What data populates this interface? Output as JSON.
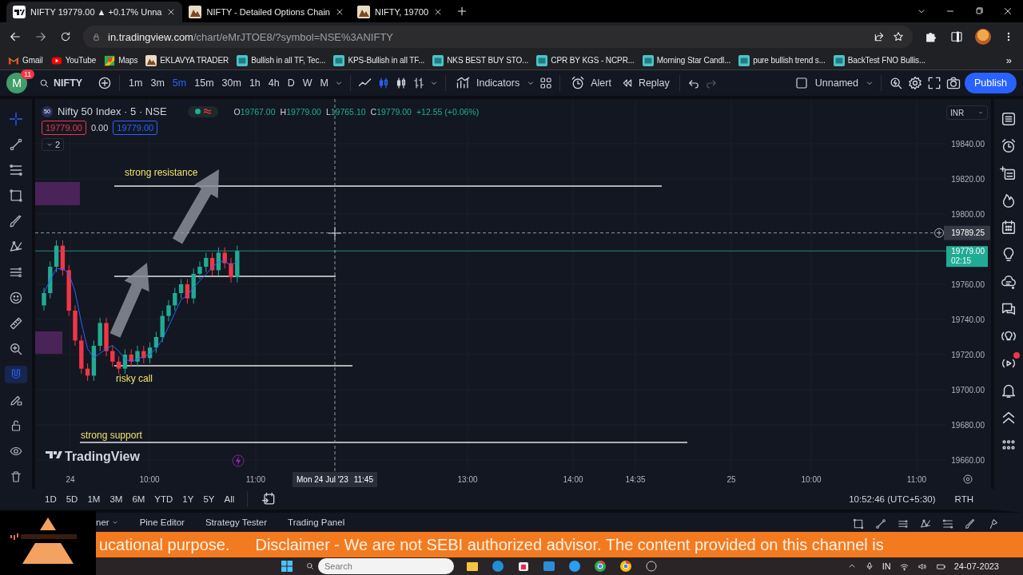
{
  "browser": {
    "tabs": [
      {
        "title": "NIFTY 19779.00 ▲ +0.17% Unna",
        "kind": "chart",
        "selected": true
      },
      {
        "title": "NIFTY - Detailed Options Chain",
        "kind": "site",
        "selected": false
      },
      {
        "title": "NIFTY, 19700",
        "kind": "site",
        "selected": false
      }
    ],
    "address": {
      "domain": "in.tradingview.com",
      "path": "/chart/eMrJTOE8/?symbol=NSE%3ANIFTY"
    },
    "bookmarks": [
      {
        "label": "Gmail",
        "kind": "gmail"
      },
      {
        "label": "YouTube",
        "kind": "youtube"
      },
      {
        "label": "Maps",
        "kind": "maps"
      },
      {
        "label": "EKLAVYA TRADER",
        "kind": "site"
      },
      {
        "label": "Bullish in all TF, Tec...",
        "kind": "screener"
      },
      {
        "label": "KPS-Bullish in all TF...",
        "kind": "screener"
      },
      {
        "label": "NKS BEST BUY STO...",
        "kind": "screener"
      },
      {
        "label": "CPR BY KGS - NCPR...",
        "kind": "screener"
      },
      {
        "label": "Morning Star Candl...",
        "kind": "screener"
      },
      {
        "label": "pure bullish trend s...",
        "kind": "screener"
      },
      {
        "label": "BackTest FNO Bullis...",
        "kind": "screener"
      }
    ],
    "more": "»"
  },
  "toolbar": {
    "avatar": "M",
    "notifications": "11",
    "symbol": "NIFTY",
    "intervals": [
      {
        "label": "1m",
        "selected": false
      },
      {
        "label": "3m",
        "selected": false
      },
      {
        "label": "5m",
        "selected": true
      },
      {
        "label": "15m",
        "selected": false
      },
      {
        "label": "30m",
        "selected": false
      },
      {
        "label": "1h",
        "selected": false
      },
      {
        "label": "4h",
        "selected": false
      },
      {
        "label": "D",
        "selected": false
      },
      {
        "label": "W",
        "selected": false
      },
      {
        "label": "M",
        "selected": false
      }
    ],
    "indicators": "Indicators",
    "alert": "Alert",
    "replay": "Replay",
    "layout": "Unnamed",
    "publish": "Publish"
  },
  "drawing_tools": {
    "magnet_on": true
  },
  "chart": {
    "symbol_badge": "50",
    "title": "Nifty 50 Index · 5 · NSE",
    "ohlc": [
      {
        "label": "O",
        "value": "19767.00"
      },
      {
        "label": "H",
        "value": "19779.00"
      },
      {
        "label": "L",
        "value": "19765.10"
      },
      {
        "label": "C",
        "value": "19779.00"
      }
    ],
    "change": "+12.55 (+0.06%)",
    "sell_price": "19779.00",
    "spread": "0.00",
    "buy_price": "19779.00",
    "indicator_count": "2",
    "currency": "INR",
    "price_ticks": [
      "19840.00",
      "19820.00",
      "19800.00",
      "19760.00",
      "19740.00",
      "19720.00",
      "19700.00",
      "19680.00",
      "19660.00"
    ],
    "crosshair_price": "19789.25",
    "last_price": "19779.00",
    "countdown": "02:15",
    "time_ticks": [
      "24",
      "10:00",
      "11:00",
      "13:00",
      "14:00",
      "14:35",
      "25",
      "10:00",
      "11:00"
    ],
    "crosshair_date": "Mon 24 Jul '23",
    "crosshair_time": "11:45",
    "annotations": [
      {
        "text": "strong resistance"
      },
      {
        "text": "risky call"
      },
      {
        "text": "strong support"
      }
    ],
    "watermark": "TradingView"
  },
  "bottom": {
    "ranges": [
      "1D",
      "5D",
      "1M",
      "3M",
      "6M",
      "YTD",
      "1Y",
      "5Y",
      "All"
    ],
    "clock": "10:52:46 (UTC+5:30)",
    "session": "RTH",
    "panel_tabs": [
      "ner",
      "Pine Editor",
      "Strategy Tester",
      "Trading Panel"
    ]
  },
  "banner": {
    "lead": "ucational purpose.",
    "text": "Disclaimer - We are not SEBI authorized advisor. The content provided on this channel is"
  },
  "taskbar": {
    "search_placeholder": "Search",
    "language": "IN",
    "date": "24-07-2023"
  }
}
